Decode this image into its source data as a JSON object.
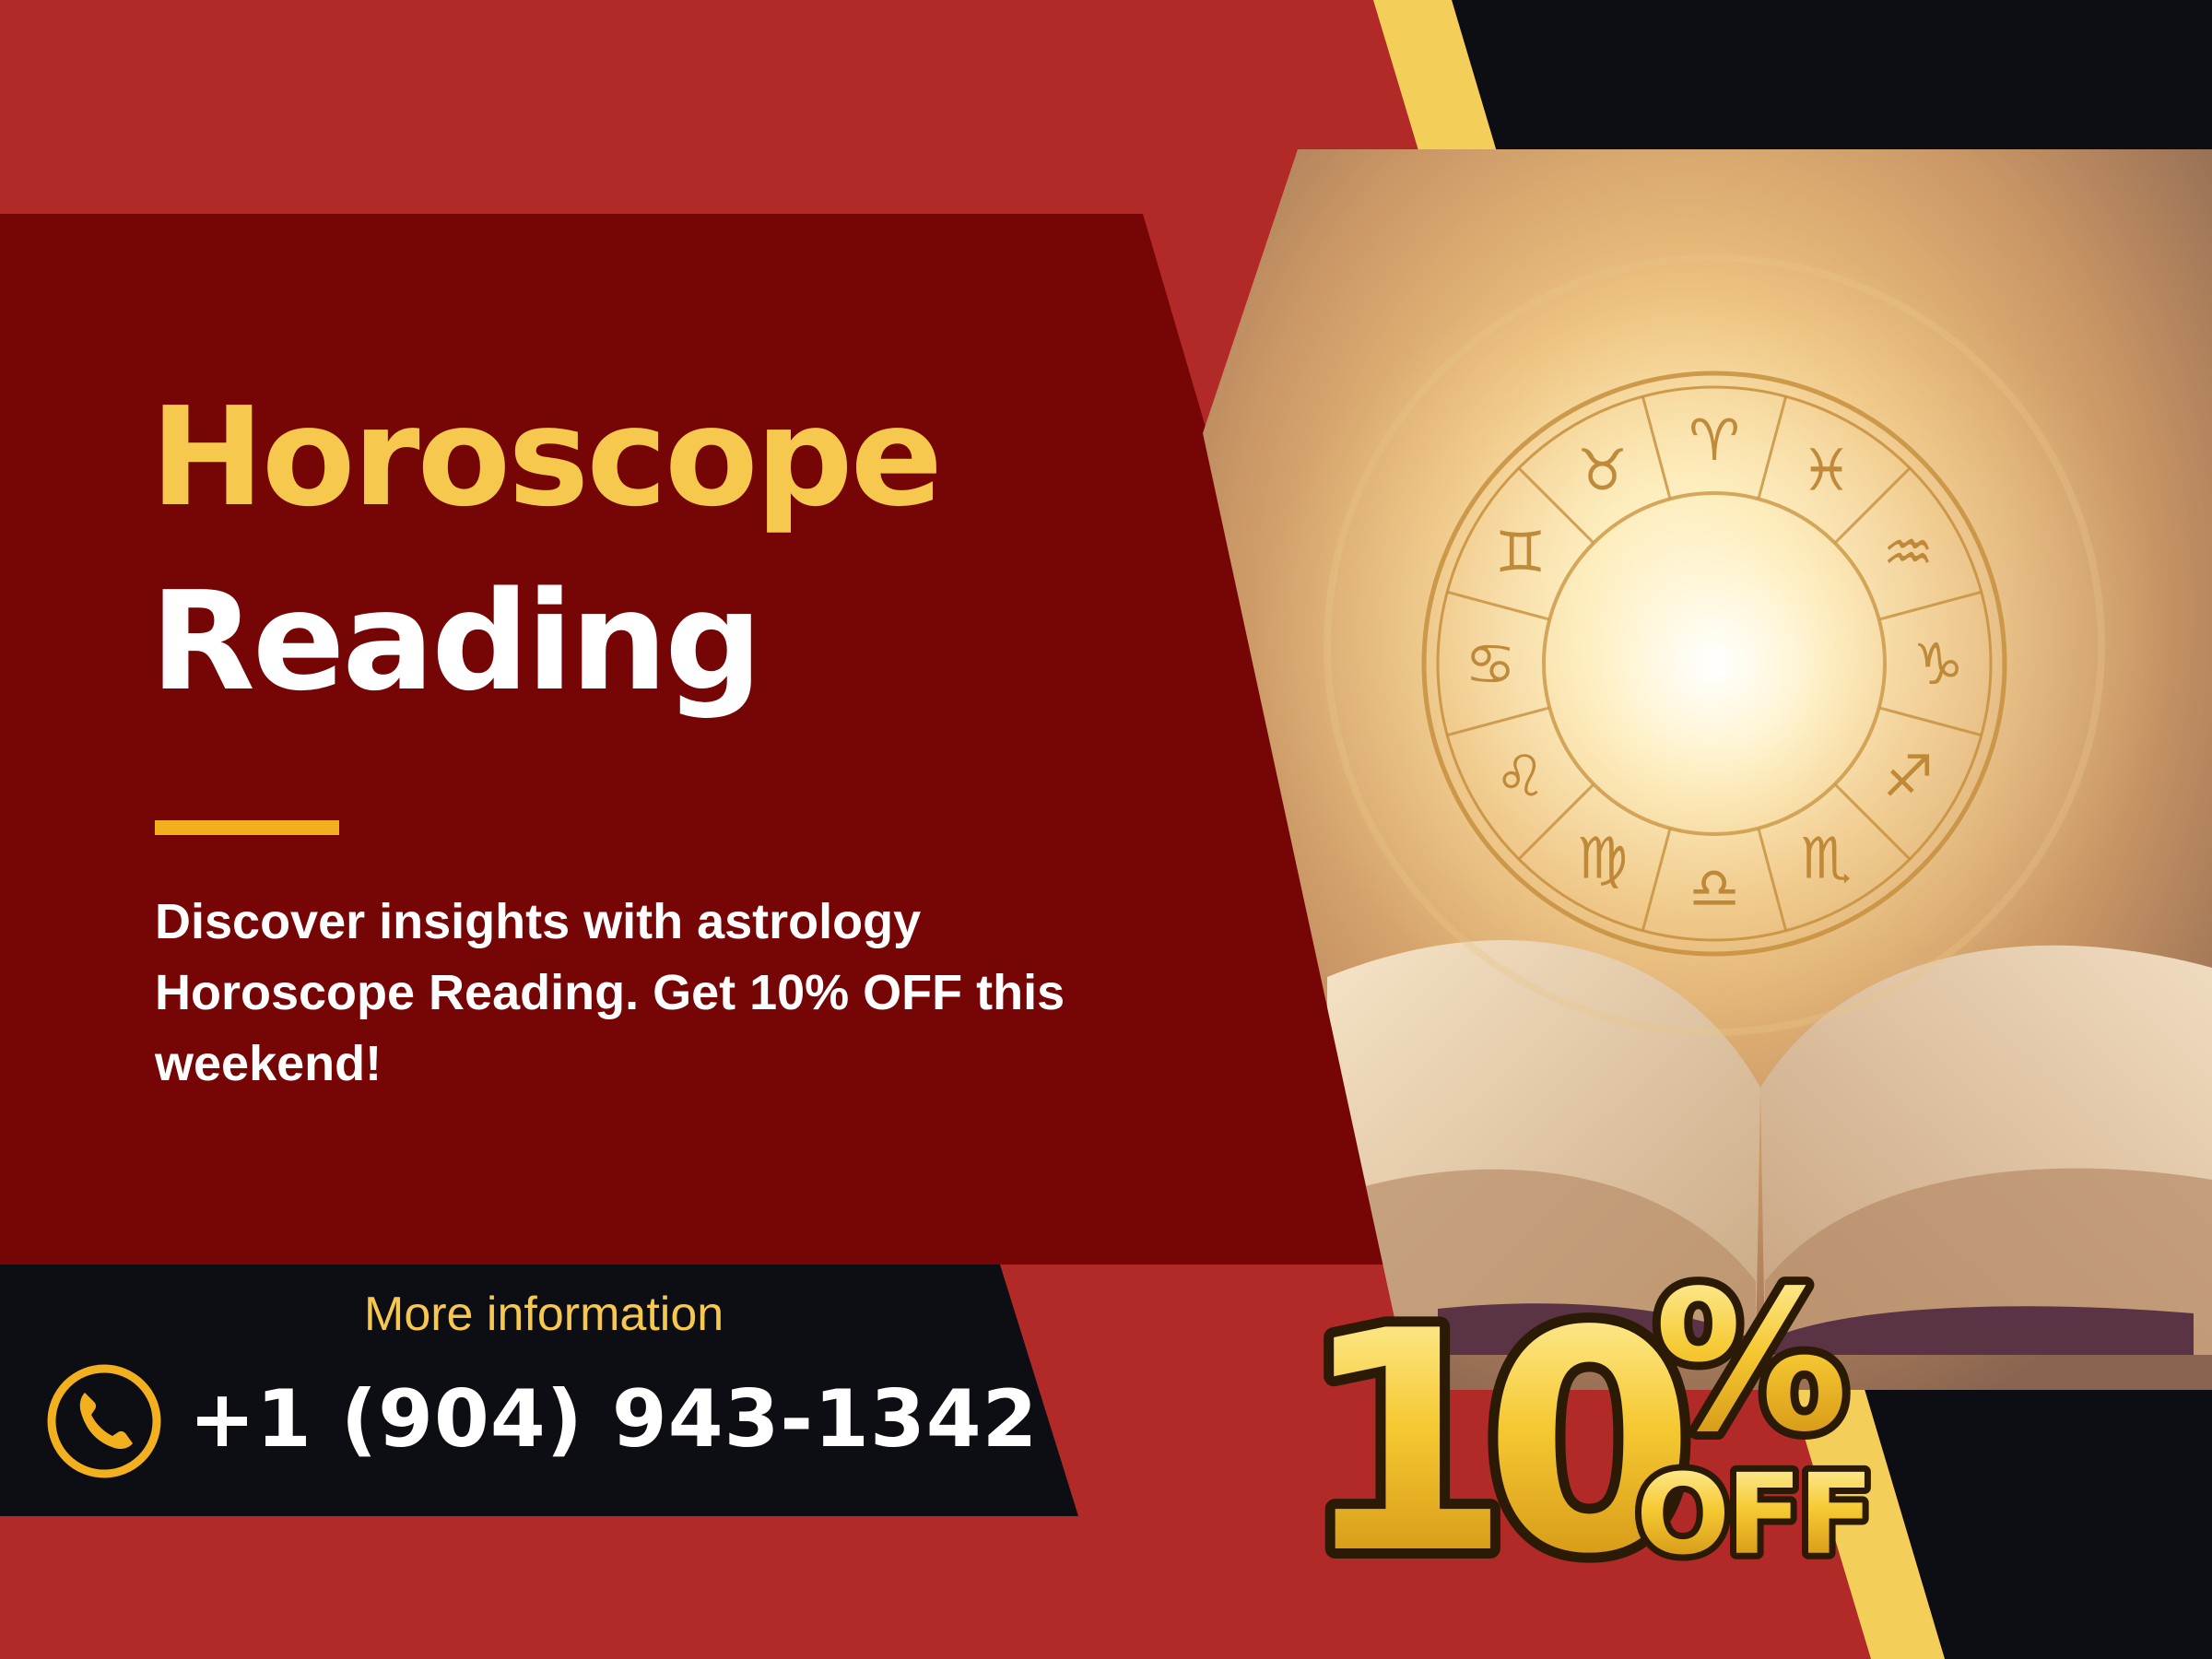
{
  "headline": {
    "line_1": "Horoscope",
    "line_2": "Reading"
  },
  "description": "Discover insights with astrology Horoscope Reading. Get 10% OFF this weekend!",
  "contact": {
    "label": "More information",
    "phone": "+1 (904) 943-1342",
    "icon": "phone-icon"
  },
  "badge": {
    "number": "10",
    "percent": "%",
    "suffix": "OFF"
  },
  "photo": {
    "zodiac_glyphs": [
      "♈",
      "♓",
      "♒",
      "♑",
      "♐",
      "♏",
      "♎",
      "♍",
      "♌",
      "♋",
      "♊",
      "♉"
    ]
  },
  "colors": {
    "background_red": "#b12a27",
    "panel_maroon": "#760506",
    "gold": "#f6c94e",
    "black": "#0d0d14"
  }
}
